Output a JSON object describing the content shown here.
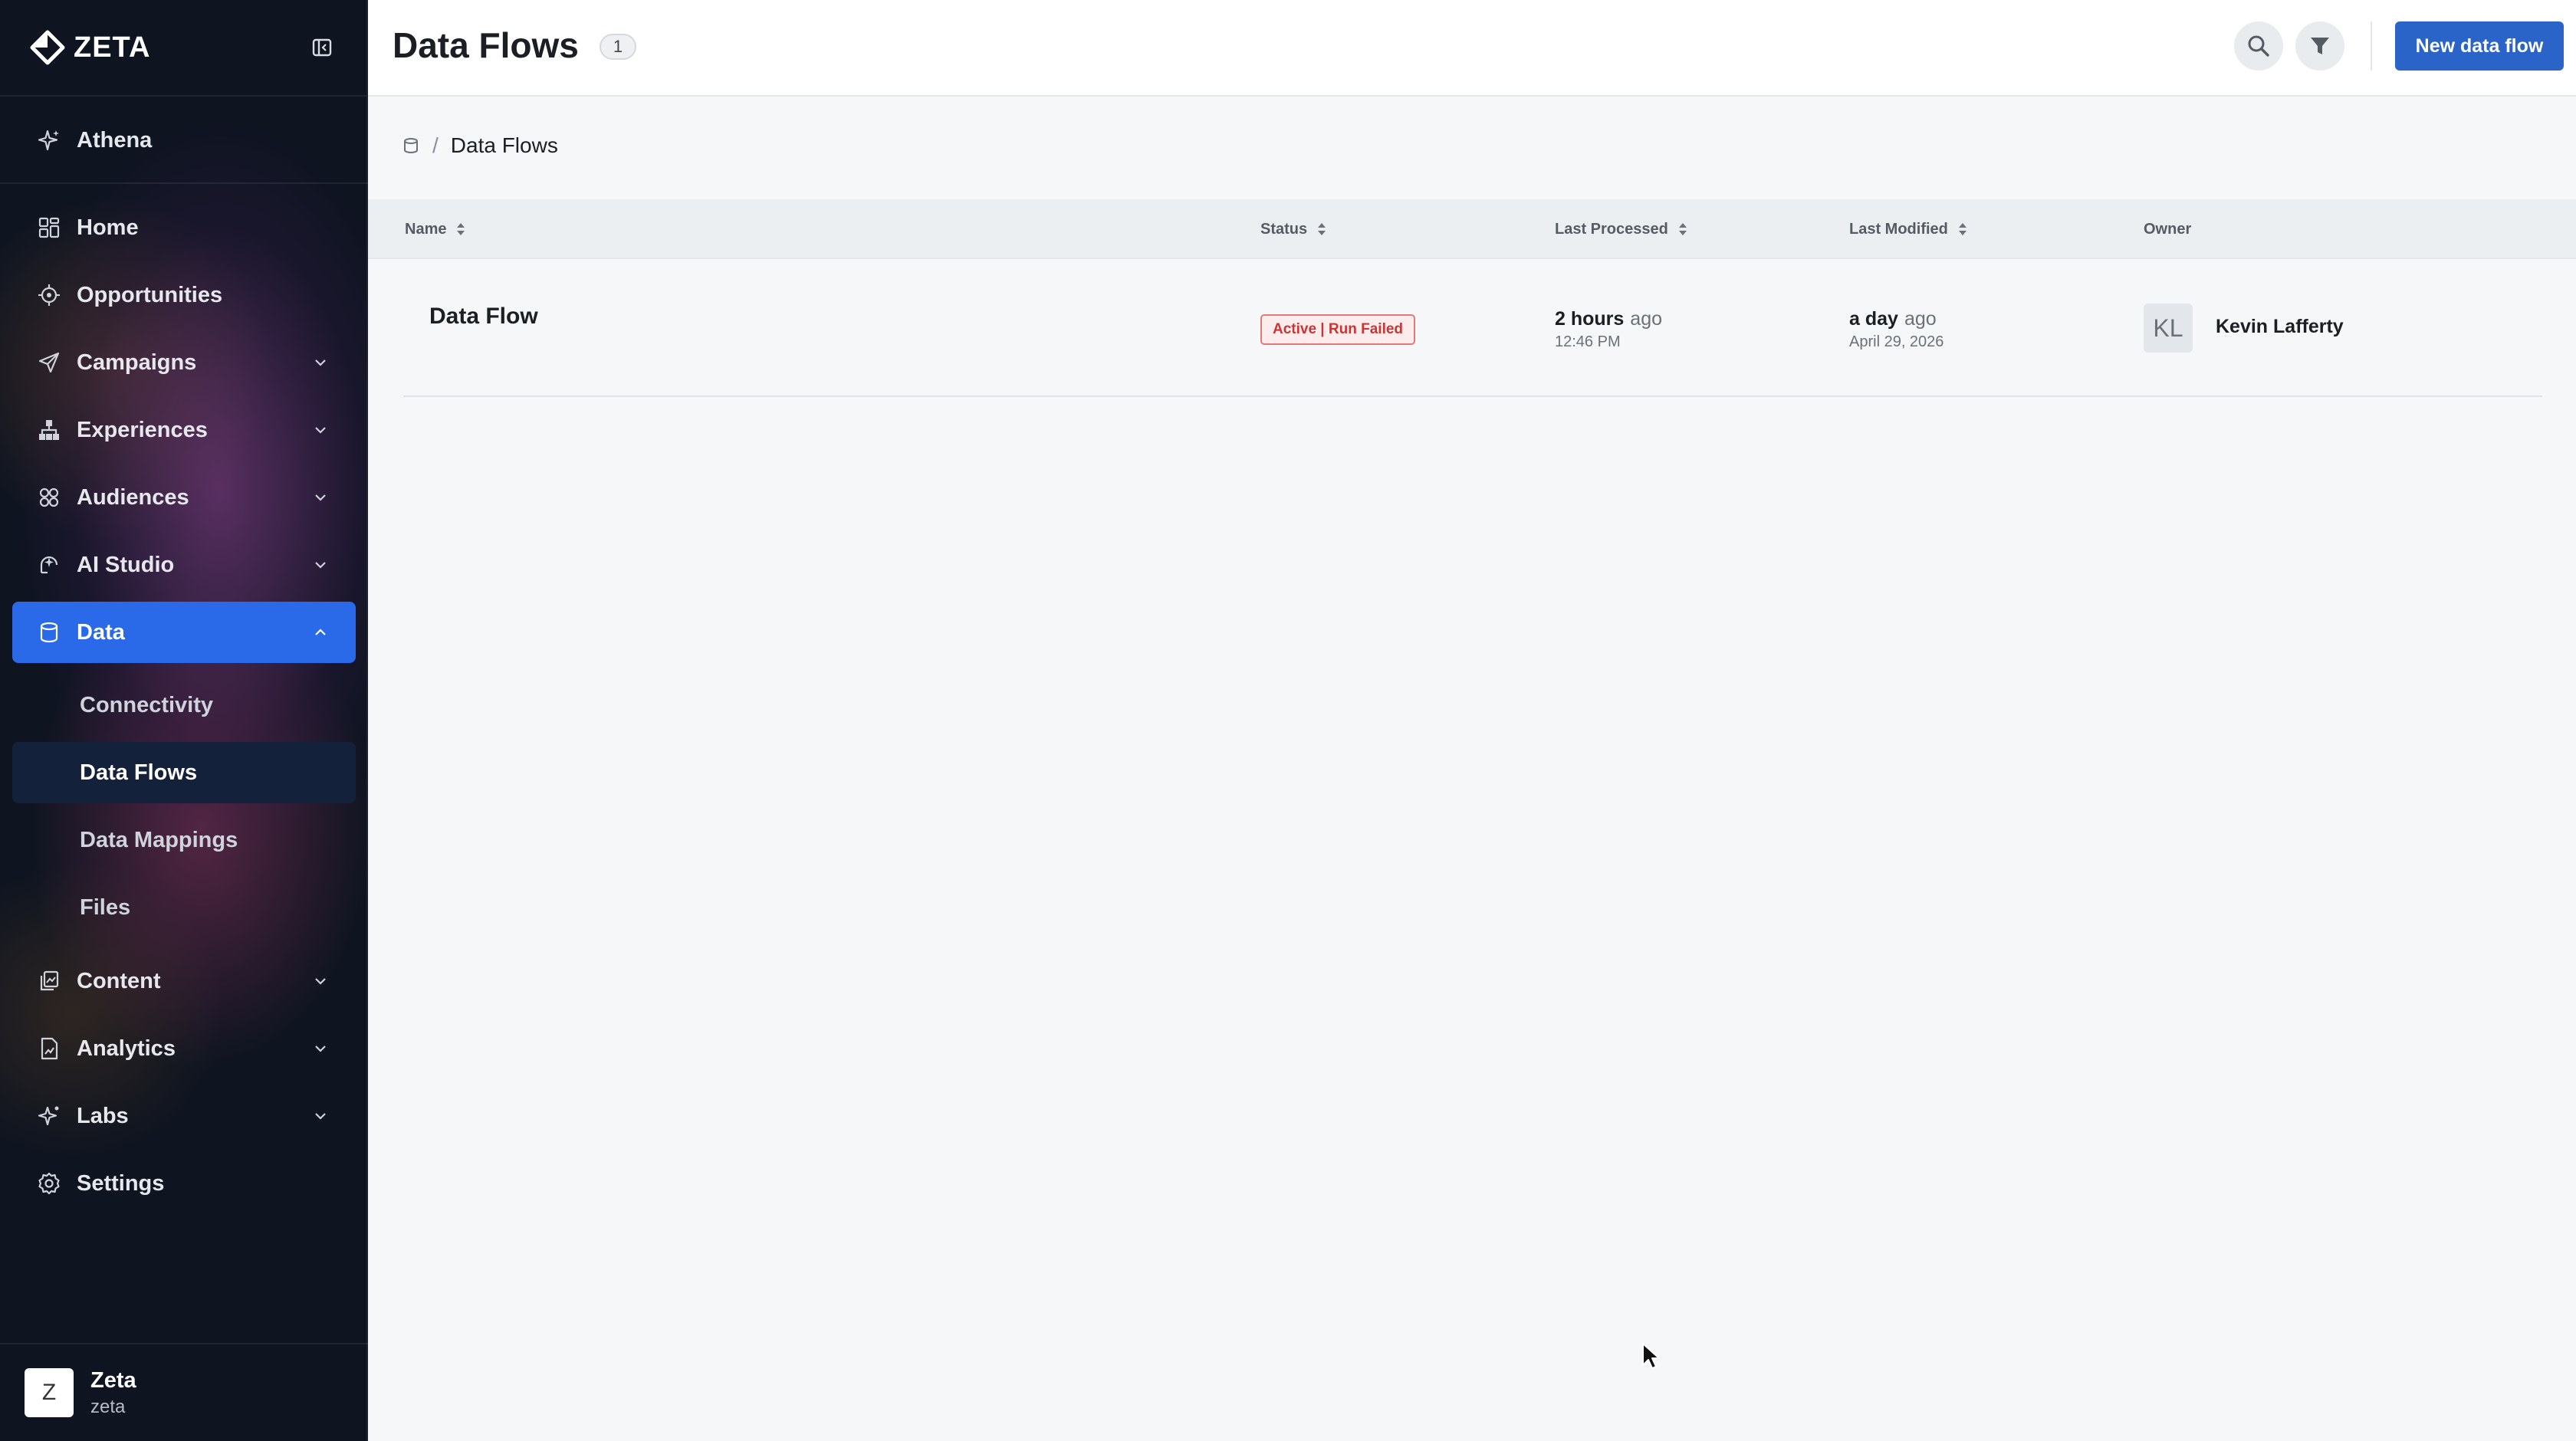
{
  "brand": {
    "name": "ZETA"
  },
  "sidebar": {
    "items": [
      {
        "label": "Athena",
        "icon": "sparkle-icon"
      },
      {
        "label": "Home",
        "icon": "grid-icon"
      },
      {
        "label": "Opportunities",
        "icon": "target-icon"
      },
      {
        "label": "Campaigns",
        "icon": "send-icon"
      },
      {
        "label": "Experiences",
        "icon": "hierarchy-icon"
      },
      {
        "label": "Audiences",
        "icon": "audience-icon"
      },
      {
        "label": "AI Studio",
        "icon": "ai-studio-icon"
      },
      {
        "label": "Data",
        "icon": "database-icon"
      },
      {
        "label": "Content",
        "icon": "content-icon"
      },
      {
        "label": "Analytics",
        "icon": "analytics-icon"
      },
      {
        "label": "Labs",
        "icon": "labs-icon"
      },
      {
        "label": "Settings",
        "icon": "gear-icon"
      }
    ],
    "data_subitems": [
      {
        "label": "Connectivity"
      },
      {
        "label": "Data Flows"
      },
      {
        "label": "Data Mappings"
      },
      {
        "label": "Files"
      }
    ],
    "footer": {
      "avatar_letter": "Z",
      "org_name": "Zeta",
      "org_sub": "zeta"
    }
  },
  "header": {
    "title": "Data Flows",
    "count": "1",
    "new_button_label": "New data flow"
  },
  "breadcrumb": {
    "current": "Data Flows",
    "separator": "/"
  },
  "table": {
    "columns": [
      {
        "label": "Name",
        "sortable": true
      },
      {
        "label": "Status",
        "sortable": true
      },
      {
        "label": "Last Processed",
        "sortable": true
      },
      {
        "label": "Last Modified",
        "sortable": true
      },
      {
        "label": "Owner",
        "sortable": false
      }
    ],
    "rows": [
      {
        "name": "Data Flow",
        "status": "Active | Run Failed",
        "last_processed_rel": "2 hours",
        "last_processed_ago": "ago",
        "last_processed_abs": "12:46 PM",
        "last_modified_rel": "a day",
        "last_modified_ago": "ago",
        "last_modified_abs": "April 29, 2026",
        "owner_initials": "KL",
        "owner_name": "Kevin Lafferty"
      }
    ]
  },
  "colors": {
    "accent": "#2a64c9",
    "nav_active": "#2a6ae8",
    "status_error": "#c93535",
    "sidebar_bg": "#0e1420"
  }
}
